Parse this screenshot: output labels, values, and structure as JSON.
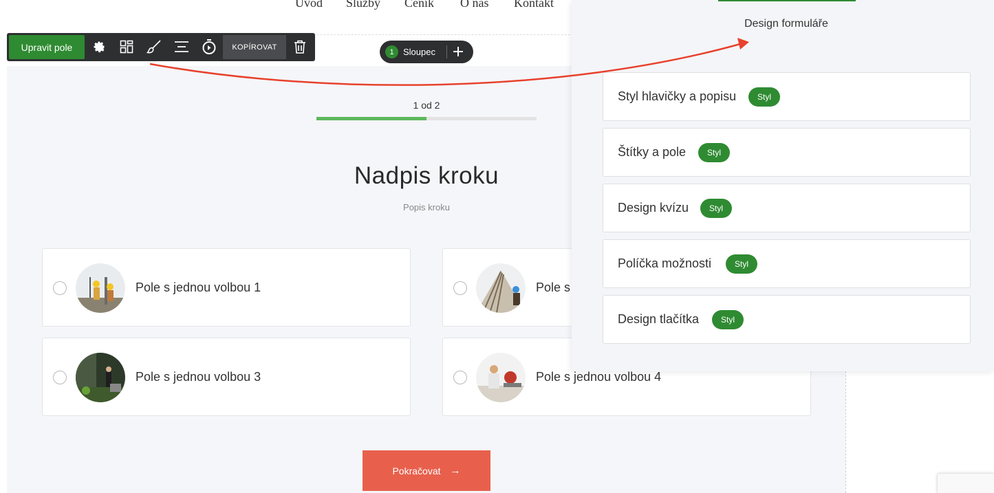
{
  "topnav": [
    "Úvod",
    "Služby",
    "Ceník",
    "O nás",
    "Kontakt"
  ],
  "toolbar": {
    "edit_label": "Upravit pole",
    "copy_label": "KOPÍROVAT",
    "icons": [
      "gear-icon",
      "layout-icon",
      "brush-icon",
      "align-icon",
      "timer-icon",
      "trash-icon"
    ]
  },
  "column": {
    "number": "1",
    "label": "Sloupec"
  },
  "progress": {
    "text": "1 od  2",
    "fraction": 0.5,
    "fill_color": "#5cb85c"
  },
  "step": {
    "title": "Nadpis kroku",
    "description": "Popis kroku"
  },
  "options": [
    {
      "label": "Pole s jednou volbou 1"
    },
    {
      "label": "Pole s"
    },
    {
      "label": "Pole s jednou volbou 3"
    },
    {
      "label": "Pole s jednou volbou 4"
    }
  ],
  "continue": {
    "label": "Pokračovat",
    "arrow": "→",
    "color": "#e8604c"
  },
  "panel": {
    "title": "Design formuláře",
    "badge_label": "Styl",
    "items": [
      {
        "label": "Styl hlavičky a popisu"
      },
      {
        "label": "Štítky a pole"
      },
      {
        "label": "Design kvízu"
      },
      {
        "label": "Políčka možnosti"
      },
      {
        "label": "Design tlačítka"
      }
    ]
  },
  "colors": {
    "accent": "#2f8b32",
    "toolbar": "#2e2f31",
    "annotation": "#e8412c"
  }
}
